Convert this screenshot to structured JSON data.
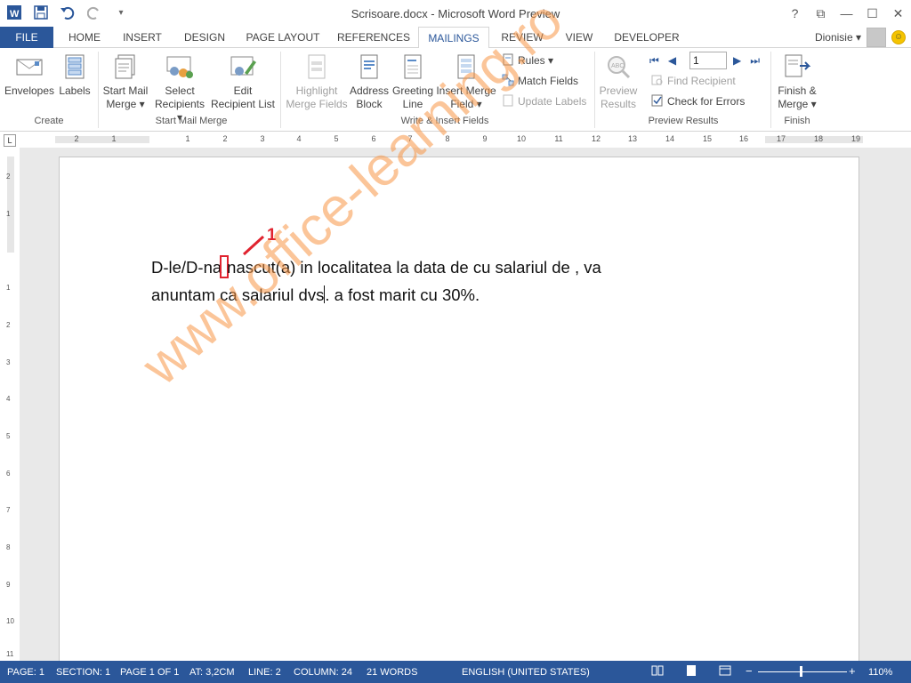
{
  "window": {
    "title": "Scrisoare.docx - Microsoft Word Preview"
  },
  "quick_access": {
    "icons": [
      "word-icon",
      "save-icon",
      "undo-icon",
      "redo-icon",
      "customize-icon"
    ]
  },
  "window_controls": {
    "help": "?",
    "restore_ribbon": "⧉",
    "minimize": "—",
    "maximize": "☐",
    "close": "✕"
  },
  "tabs": [
    {
      "label": "FILE"
    },
    {
      "label": "HOME"
    },
    {
      "label": "INSERT"
    },
    {
      "label": "DESIGN"
    },
    {
      "label": "PAGE LAYOUT"
    },
    {
      "label": "REFERENCES"
    },
    {
      "label": "MAILINGS"
    },
    {
      "label": "REVIEW"
    },
    {
      "label": "VIEW"
    },
    {
      "label": "DEVELOPER"
    }
  ],
  "user": {
    "name": "Dionisie ▾"
  },
  "ribbon": {
    "create": {
      "group_label": "Create",
      "envelopes": "Envelopes",
      "labels": "Labels"
    },
    "start_mail_merge": {
      "group_label": "Start Mail Merge",
      "start": [
        "Start Mail",
        "Merge ▾"
      ],
      "select": [
        "Select",
        "Recipients ▾"
      ],
      "edit": [
        "Edit",
        "Recipient List"
      ]
    },
    "write_insert": {
      "group_label": "Write & Insert Fields",
      "highlight": [
        "Highlight",
        "Merge Fields"
      ],
      "address": [
        "Address",
        "Block"
      ],
      "greeting": [
        "Greeting",
        "Line"
      ],
      "insert_field": [
        "Insert Merge",
        "Field ▾"
      ],
      "rules": "Rules ▾",
      "match_fields": "Match Fields",
      "update_labels": "Update Labels"
    },
    "preview": {
      "group_label": "Preview Results",
      "preview": [
        "Preview",
        "Results"
      ],
      "record_value": "1",
      "find_recipient": "Find Recipient",
      "check_errors": "Check for Errors"
    },
    "finish": {
      "group_label": "Finish",
      "finish": [
        "Finish &",
        "Merge ▾"
      ]
    }
  },
  "ruler": {
    "h_labels": [
      "2",
      "1",
      "1",
      "2",
      "3",
      "4",
      "5",
      "6",
      "7",
      "8",
      "9",
      "10",
      "11",
      "12",
      "13",
      "14",
      "15",
      "16",
      "17",
      "18",
      "19"
    ],
    "v_labels": [
      "2",
      "1",
      "1",
      "2",
      "3",
      "4",
      "5",
      "6",
      "7",
      "8",
      "9",
      "10",
      "11"
    ]
  },
  "document": {
    "part1": "D-le/D-na",
    "part2": "nascut(a) in localitatea  la data de  cu salariul de , va",
    "part3": "anuntam ca salariul dvs",
    "part4": ". a fost marit cu 30%."
  },
  "annotation": {
    "label": "1"
  },
  "watermark": {
    "text": "www.office-learning.ro"
  },
  "status": {
    "page": "PAGE: 1",
    "section": "SECTION: 1",
    "page_of": "PAGE 1 OF 1",
    "at": "AT: 3,2CM",
    "line": "LINE: 2",
    "column": "COLUMN: 24",
    "words": "21 WORDS",
    "language": "ENGLISH (UNITED STATES)",
    "zoom": "110%"
  },
  "colors": {
    "accent": "#2b579a",
    "annotation": "#e0232f",
    "watermark": "#f89646"
  }
}
